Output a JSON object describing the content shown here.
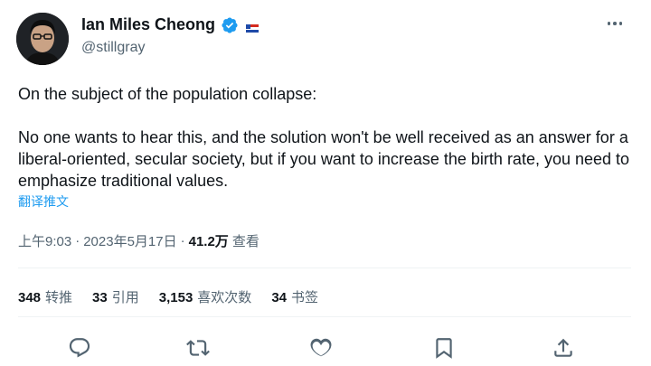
{
  "author": {
    "display_name": "Ian Miles Cheong",
    "handle": "@stillgray"
  },
  "tweet": {
    "paragraph_1": "On the subject of the population collapse:",
    "paragraph_2": "No one wants to hear this, and the solution won't be well received as an answer for a liberal-oriented, secular society, but if you want to increase the birth rate, you need to emphasize traditional values.",
    "translate_label": "翻译推文"
  },
  "meta": {
    "time": "上午9:03",
    "separator_1": "·",
    "date": "2023年5月17日",
    "separator_2": "·",
    "views_count": "41.2万",
    "views_label": "查看"
  },
  "stats": {
    "retweets_count": "348",
    "retweets_label": "转推",
    "quotes_count": "33",
    "quotes_label": "引用",
    "likes_count": "3,153",
    "likes_label": "喜欢次数",
    "bookmarks_count": "34",
    "bookmarks_label": "书签"
  },
  "icons": {
    "verified": "verified-badge-icon",
    "flag": "flag-icon",
    "more": "more-icon",
    "reply": "reply-icon",
    "retweet": "retweet-icon",
    "like": "heart-icon",
    "bookmark": "bookmark-icon",
    "share": "share-icon"
  },
  "colors": {
    "accent": "#1d9bf0",
    "text": "#0f1419",
    "secondary": "#536471",
    "divider": "#eff3f4"
  }
}
